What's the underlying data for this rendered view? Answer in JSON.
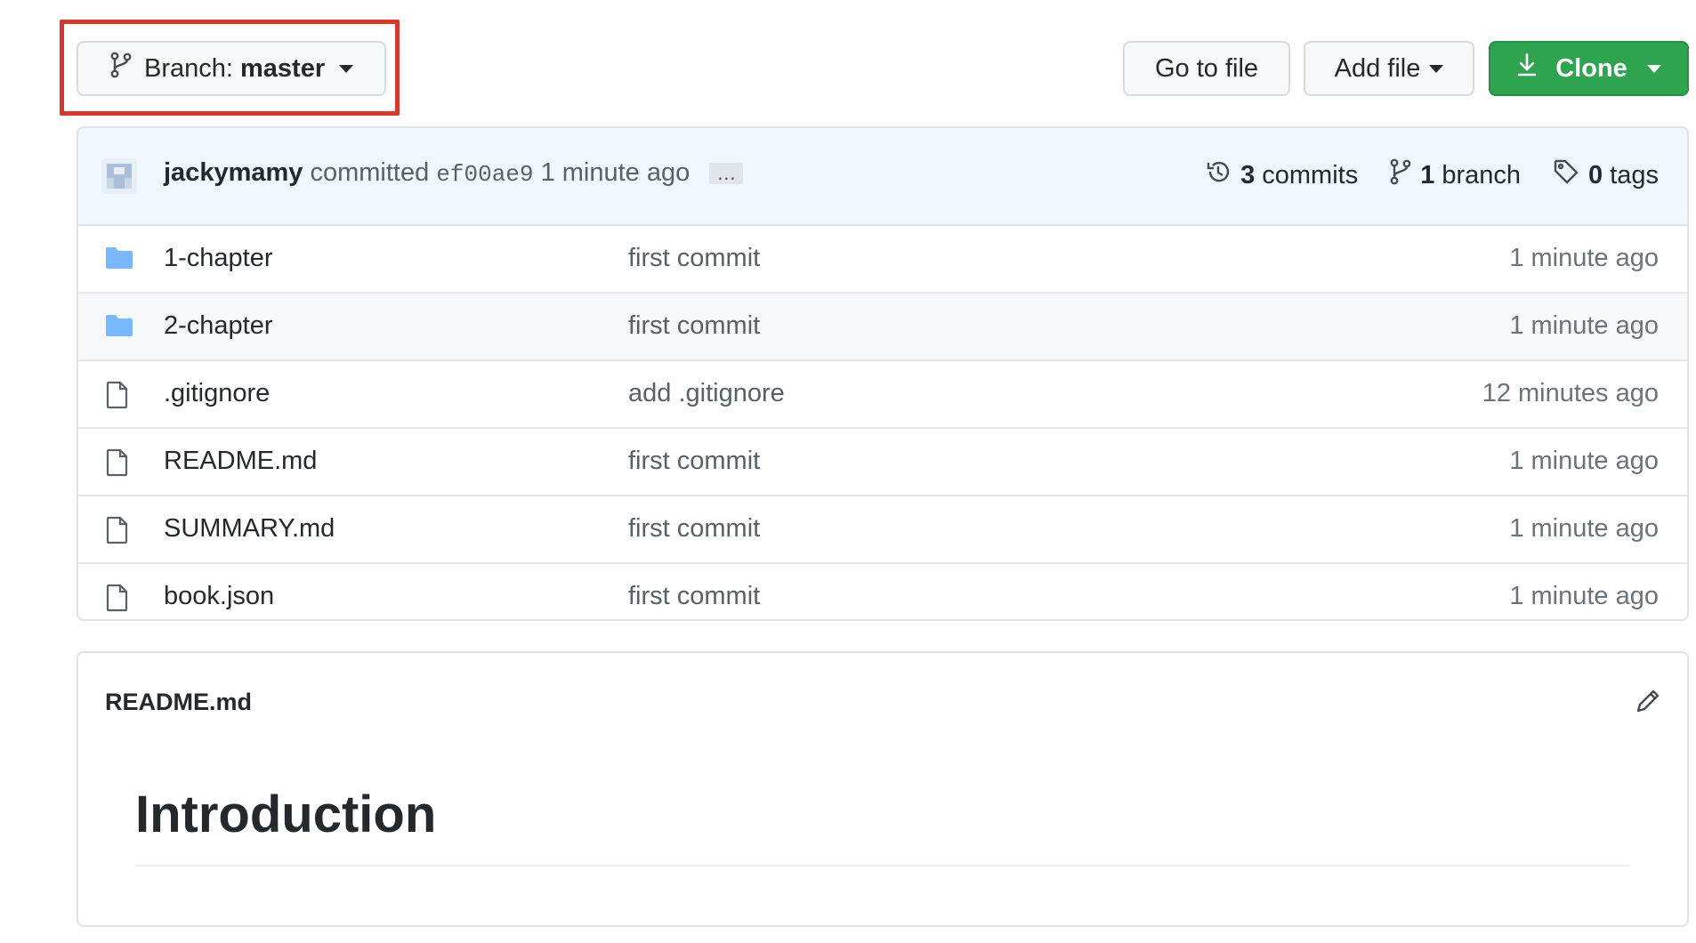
{
  "toolbar": {
    "branch_prefix": "Branch:",
    "branch_name": "master",
    "goto_label": "Go to file",
    "add_label": "Add file",
    "clone_label": "Clone"
  },
  "commit": {
    "author": "jackymamy",
    "verb": "committed",
    "sha": "ef00ae9",
    "time": "1 minute ago",
    "ellipsis": "…",
    "commits_count": "3",
    "commits_label": "commits",
    "branch_count": "1",
    "branch_label": "branch",
    "tags_count": "0",
    "tags_label": "tags"
  },
  "files": [
    {
      "name": "1-chapter",
      "type": "folder",
      "message": "first commit",
      "age": "1 minute ago"
    },
    {
      "name": "2-chapter",
      "type": "folder",
      "message": "first commit",
      "age": "1 minute ago"
    },
    {
      "name": ".gitignore",
      "type": "file",
      "message": "add .gitignore",
      "age": "12 minutes ago"
    },
    {
      "name": "README.md",
      "type": "file",
      "message": "first commit",
      "age": "1 minute ago"
    },
    {
      "name": "SUMMARY.md",
      "type": "file",
      "message": "first commit",
      "age": "1 minute ago"
    },
    {
      "name": "book.json",
      "type": "file",
      "message": "first commit",
      "age": "1 minute ago"
    }
  ],
  "readme": {
    "title": "README.md",
    "heading": "Introduction"
  },
  "colors": {
    "highlight": "#d13a2c",
    "clone_green": "#2ea44f",
    "folder_blue": "#79b8ff"
  }
}
